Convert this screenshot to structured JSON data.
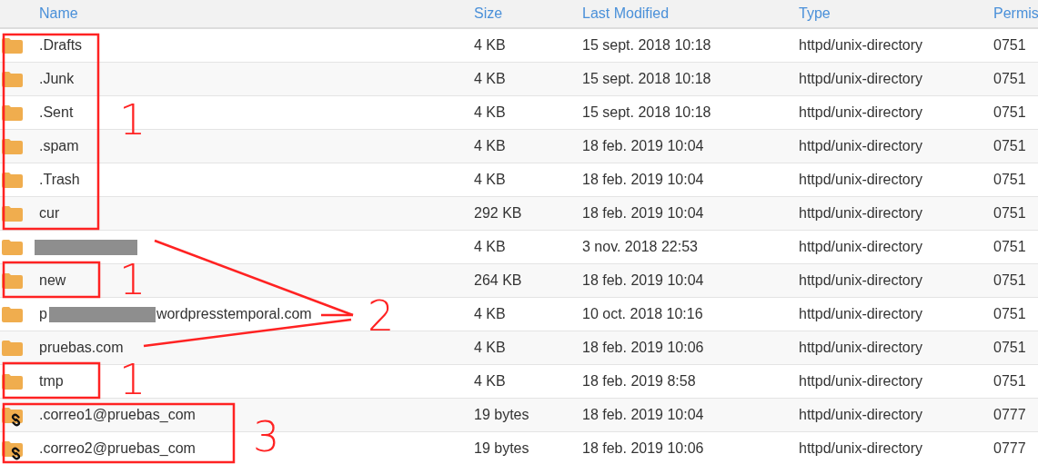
{
  "table": {
    "columns": [
      "Name",
      "Size",
      "Last Modified",
      "Type",
      "Permis"
    ],
    "rows": [
      {
        "kind": "folder",
        "name": ".Drafts",
        "size": "4 KB",
        "modified": "15 sept. 2018 10:18",
        "type": "httpd/unix-directory",
        "perms": "0751"
      },
      {
        "kind": "folder",
        "name": ".Junk",
        "size": "4 KB",
        "modified": "15 sept. 2018 10:18",
        "type": "httpd/unix-directory",
        "perms": "0751"
      },
      {
        "kind": "folder",
        "name": ".Sent",
        "size": "4 KB",
        "modified": "15 sept. 2018 10:18",
        "type": "httpd/unix-directory",
        "perms": "0751"
      },
      {
        "kind": "folder",
        "name": ".spam",
        "size": "4 KB",
        "modified": "18 feb. 2019 10:04",
        "type": "httpd/unix-directory",
        "perms": "0751"
      },
      {
        "kind": "folder",
        "name": ".Trash",
        "size": "4 KB",
        "modified": "18 feb. 2019 10:04",
        "type": "httpd/unix-directory",
        "perms": "0751"
      },
      {
        "kind": "folder",
        "name": "cur",
        "size": "292 KB",
        "modified": "18 feb. 2019 10:04",
        "type": "httpd/unix-directory",
        "perms": "0751"
      },
      {
        "kind": "folder",
        "redacted": true,
        "size": "4 KB",
        "modified": "3 nov. 2018 22:53",
        "type": "httpd/unix-directory",
        "perms": "0751"
      },
      {
        "kind": "folder",
        "name": "new",
        "size": "264 KB",
        "modified": "18 feb. 2019 10:04",
        "type": "httpd/unix-directory",
        "perms": "0751"
      },
      {
        "kind": "folder",
        "name_start": "p",
        "redacted": true,
        "name": "wordpresstemporal.com",
        "size": "4 KB",
        "modified": "10 oct. 2018 10:16",
        "type": "httpd/unix-directory",
        "perms": "0751"
      },
      {
        "kind": "folder",
        "name": "pruebas.com",
        "size": "4 KB",
        "modified": "18 feb. 2019 10:06",
        "type": "httpd/unix-directory",
        "perms": "0751"
      },
      {
        "kind": "folder",
        "name": "tmp",
        "size": "4 KB",
        "modified": "18 feb. 2019 8:58",
        "type": "httpd/unix-directory",
        "perms": "0751"
      },
      {
        "kind": "link",
        "name": ".correo1@pruebas_com",
        "size": "19 bytes",
        "modified": "18 feb. 2019 10:04",
        "type": "httpd/unix-directory",
        "perms": "0777"
      },
      {
        "kind": "link",
        "name": ".correo2@pruebas_com",
        "size": "19 bytes",
        "modified": "18 feb. 2019 10:06",
        "type": "httpd/unix-directory",
        "perms": "0777"
      }
    ]
  },
  "annotations": [
    {
      "label": "1"
    },
    {
      "label": "1"
    },
    {
      "label": "2"
    },
    {
      "label": "1"
    },
    {
      "label": "3"
    }
  ]
}
